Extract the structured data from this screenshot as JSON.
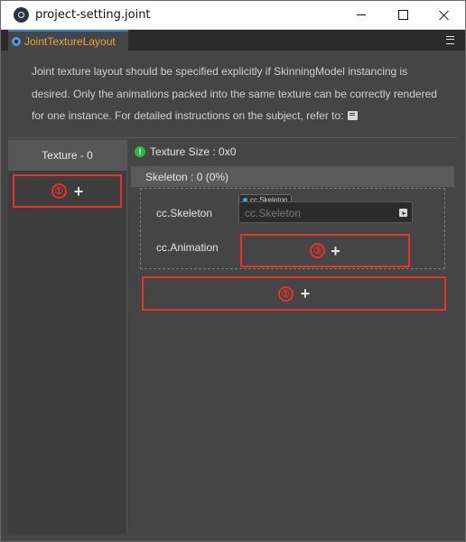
{
  "window": {
    "title": "project-setting.joint",
    "icon": "app-logo-icon"
  },
  "tab": {
    "label": "JointTextureLayout",
    "icon": "gear-icon"
  },
  "description": {
    "text": "Joint texture layout should be specified explicitly if SkinningModel instancing is desired. Only the animations packed into the same texture can be correctly rendered for one instance. For detailed instructions on the subject, refer to:",
    "link_icon": "book-icon"
  },
  "left_pane": {
    "texture_tab_label": "Texture - 0",
    "add_button": {
      "marker": "①",
      "symbol": "+"
    }
  },
  "right_pane": {
    "texture_size": "Texture Size : 0x0",
    "status_color": "#2fb44a",
    "skeleton_header": "Skeleton : 0 (0%)",
    "skeleton_label": "cc.Skeleton",
    "asset_tag": "cc.Skeleton",
    "asset_placeholder": "cc.Skeleton",
    "animation_label": "cc.Animation",
    "add_animation_button": {
      "marker": "③",
      "symbol": "+"
    },
    "add_skeleton_button": {
      "marker": "②",
      "symbol": "+"
    }
  },
  "colors": {
    "highlight": "#e5322d",
    "tab_text": "#e8a33a",
    "accent": "#2a82da"
  }
}
